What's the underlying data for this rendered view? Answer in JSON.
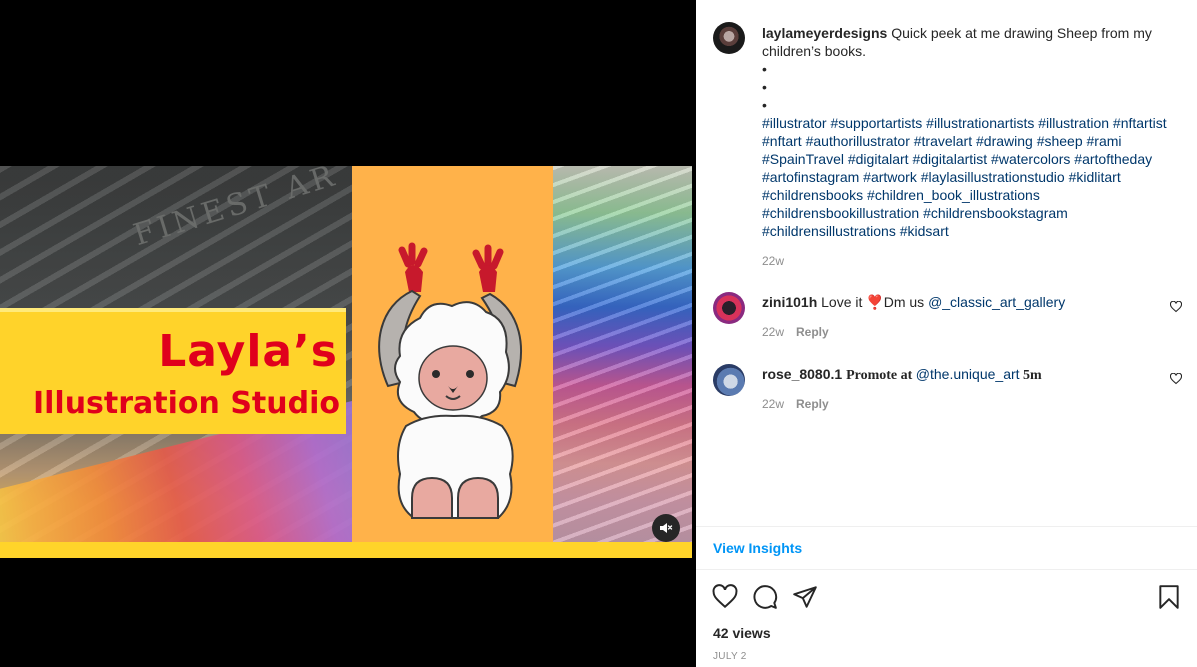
{
  "post": {
    "title_card": {
      "line1": "Layla’s",
      "line2": "Illustration Studio"
    },
    "background_text": "FINEST AR",
    "mute_icon": "speaker-muted-icon"
  },
  "caption": {
    "username": "laylameyerdesigns",
    "text": "Quick peek at me drawing Sheep from my children’s books.",
    "dots": [
      "•",
      "•",
      "•"
    ],
    "hashtags": "#illustrator #supportartists #illustrationartists #illustration #nftartist #nftart #authorillustrator #travelart #drawing #sheep #rami #SpainTravel #digitalart #digitalartist #watercolors #artoftheday #artofinstagram #artwork #laylasillustrationstudio #kidlitart #childrensbooks #children_book_illustrations #childrensbookillustration #childrensbookstagram #childrensillustrations #kidsart",
    "time": "22w"
  },
  "comments": [
    {
      "username": "zini101h",
      "text_before": "Love it ",
      "emoji": "❣️",
      "text_after": "Dm us ",
      "mention": "@_classic_art_gallery",
      "tail": "",
      "time": "22w",
      "reply": "Reply"
    },
    {
      "username": "rose_8080.1",
      "text_before": "Promote at ",
      "mention": "@the.unique_art",
      "tail": " 5m",
      "time": "22w",
      "reply": "Reply"
    }
  ],
  "insights_label": "View Insights",
  "actions": {
    "like": "heart-icon",
    "comment": "comment-icon",
    "share": "share-icon",
    "save": "bookmark-icon"
  },
  "views": "42 views",
  "date": "JULY 2",
  "colors": {
    "link": "#00376b",
    "accent": "#0095f6",
    "title_red": "#e0001c",
    "card_yellow": "#ffd32a",
    "panel_orange": "#ffb24a"
  }
}
